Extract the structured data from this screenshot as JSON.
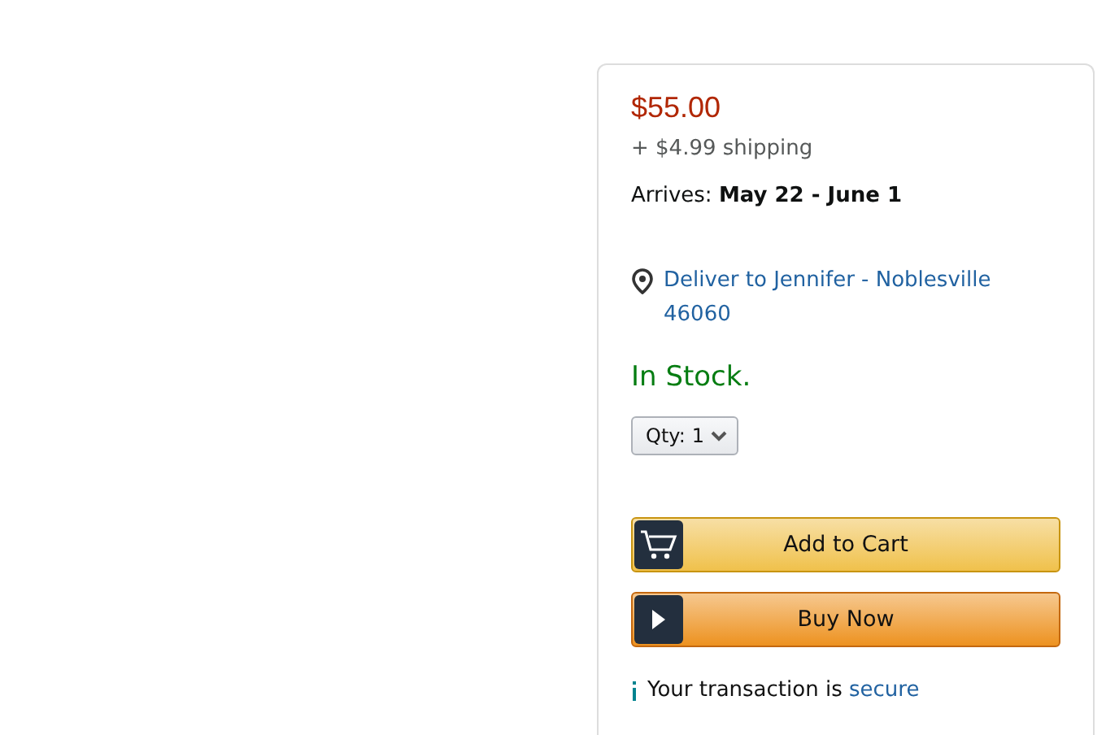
{
  "price": "$55.00",
  "shipping": "+ $4.99 shipping",
  "arrives": "Arrives: **May 22 - June 1**",
  "deliver_to": {
    "line1": "Deliver to Jennifer - Noblesville",
    "line2": "46060"
  },
  "availability": "In Stock.",
  "quantity": {
    "label": "Qty:",
    "value": "1"
  },
  "buttons": [
    {
      "kind": "cart",
      "label": "Add to Cart"
    },
    {
      "kind": "buy",
      "label": "Buy Now"
    }
  ],
  "security": {
    "text": "Your transaction is",
    "link": "secure"
  }
}
